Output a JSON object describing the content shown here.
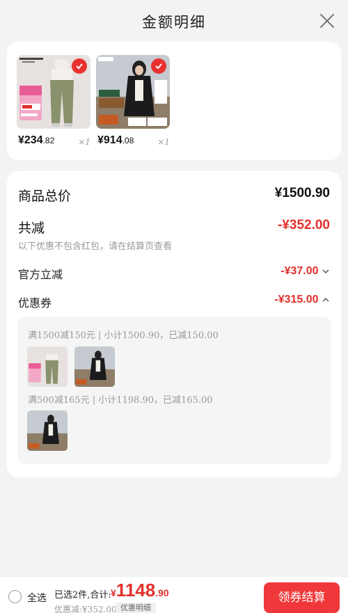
{
  "header": {
    "title": "金额明细"
  },
  "products": [
    {
      "price_int": "¥234",
      "price_dec": ".82",
      "qty": "×1",
      "thumb_icon": "pants-product-icon"
    },
    {
      "price_int": "¥914",
      "price_dec": ".08",
      "qty": "×1",
      "thumb_icon": "coat-product-icon"
    }
  ],
  "summary": {
    "total_label": "商品总价",
    "total_value": "¥1500.90",
    "reduction_label": "共减",
    "reduction_value": "-¥352.00",
    "note": "以下优惠不包含红包，请在结算页查看",
    "official_label": "官方立减",
    "official_value": "-¥37.00",
    "coupon_label": "优惠券",
    "coupon_value": "-¥315.00"
  },
  "coupons": [
    {
      "title": "满1500减150元 | 小计1500.90，已减150.00"
    },
    {
      "title": "满500减165元 | 小计1198.90，已减165.00"
    }
  ],
  "footer": {
    "select_all": "全选",
    "selected_info": "已选2件,合计:",
    "total_currency": "¥",
    "total_int": "1148",
    "total_dec": ".90",
    "discount": "优惠减:¥352.00",
    "detail_button": "优惠明细",
    "checkout_button": "领券结算"
  },
  "colors": {
    "accent": "#e3302c",
    "button": "#f0383a"
  }
}
